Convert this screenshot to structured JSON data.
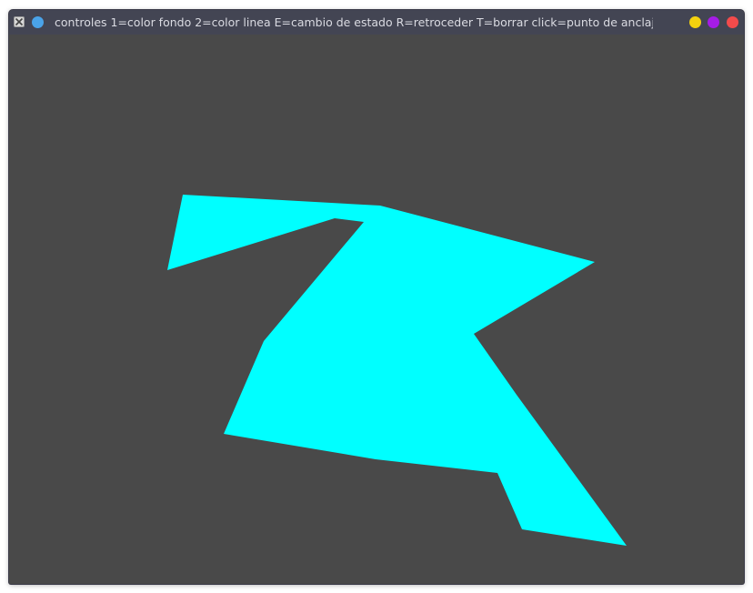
{
  "window": {
    "title": "controles 1=color fondo 2=color linea E=cambio de estado R=retroceder T=borrar click=punto de anclaje",
    "controls": {
      "minimize_color": "#f3d10f",
      "maximize_color": "#a51ce6",
      "close_color": "#f34b4b",
      "pin_color": "#4aa3e8"
    },
    "app_icon": "x11-app-icon"
  },
  "canvas": {
    "background_color": "#494949",
    "shape_fill_color": "#00ffff",
    "shape": "filled-polygon"
  }
}
